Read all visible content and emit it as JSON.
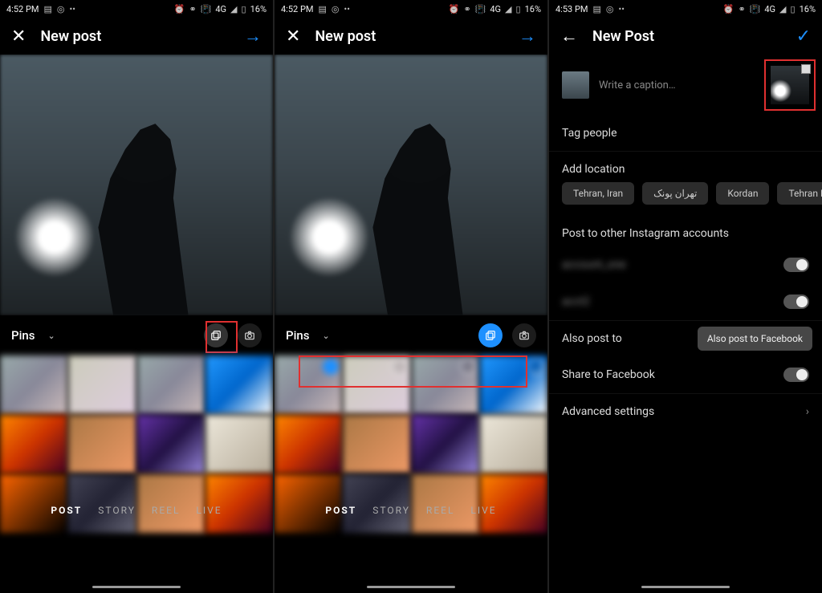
{
  "status": {
    "time1": "4:52 PM",
    "time2": "4:52 PM",
    "time3": "4:53 PM",
    "net": "4G",
    "battery": "16%"
  },
  "s1": {
    "title": "New post",
    "source": "Pins",
    "tabs": {
      "post": "POST",
      "story": "STORY",
      "reel": "REEL",
      "live": "LIVE"
    }
  },
  "s2": {
    "title": "New post",
    "source": "Pins",
    "tabs": {
      "post": "POST",
      "story": "STORY",
      "reel": "REEL",
      "live": "LIVE"
    }
  },
  "s3": {
    "title": "New Post",
    "caption_placeholder": "Write a caption…",
    "tag": "Tag people",
    "location": "Add location",
    "chips": [
      "Tehran, Iran",
      "تهران پونک",
      "Kordan",
      "Tehran Province"
    ],
    "post_other": "Post to other Instagram accounts",
    "also": "Also post to",
    "toast": "Also post to Facebook",
    "share_fb": "Share to Facebook",
    "adv": "Advanced settings"
  }
}
